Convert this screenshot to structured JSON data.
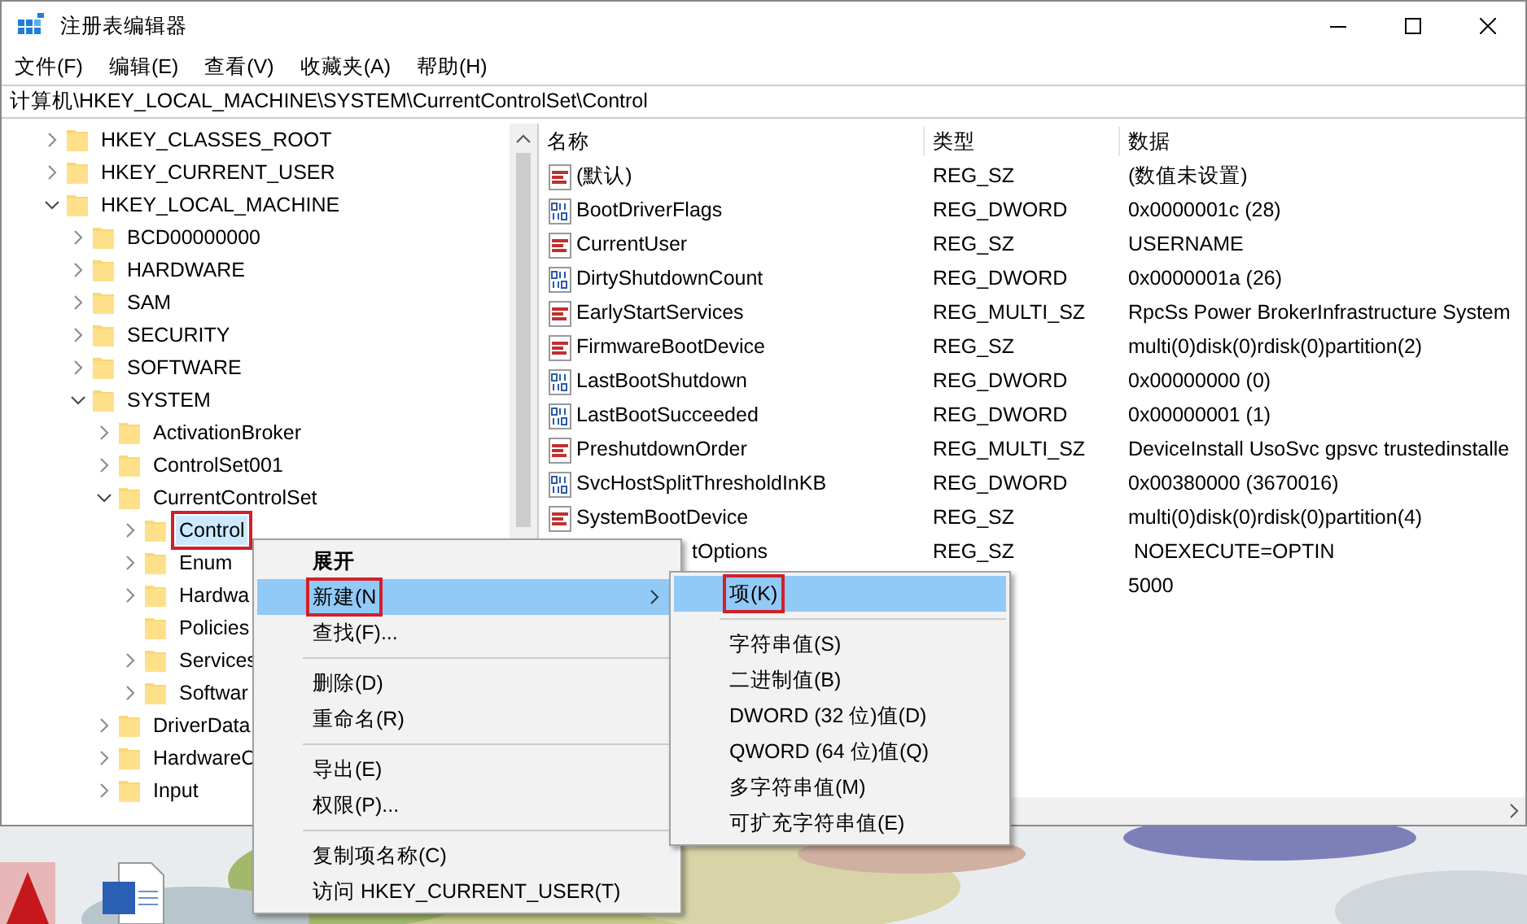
{
  "window": {
    "title": "注册表编辑器"
  },
  "menu_bar": [
    "文件(F)",
    "编辑(E)",
    "查看(V)",
    "收藏夹(A)",
    "帮助(H)"
  ],
  "address": "计算机\\HKEY_LOCAL_MACHINE\\SYSTEM\\CurrentControlSet\\Control",
  "tree": [
    {
      "label": "HKEY_CLASSES_ROOT",
      "expanded": false,
      "selected": false
    },
    {
      "label": "HKEY_CURRENT_USER",
      "expanded": false,
      "selected": false
    },
    {
      "label": "HKEY_LOCAL_MACHINE",
      "expanded": true,
      "selected": false,
      "children": [
        {
          "label": "BCD00000000",
          "expanded": false,
          "selected": false
        },
        {
          "label": "HARDWARE",
          "expanded": false,
          "selected": false
        },
        {
          "label": "SAM",
          "expanded": false,
          "selected": false
        },
        {
          "label": "SECURITY",
          "expanded": false,
          "selected": false
        },
        {
          "label": "SOFTWARE",
          "expanded": false,
          "selected": false
        },
        {
          "label": "SYSTEM",
          "expanded": true,
          "selected": false,
          "children": [
            {
              "label": "ActivationBroker",
              "expanded": false,
              "selected": false
            },
            {
              "label": "ControlSet001",
              "expanded": false,
              "selected": false
            },
            {
              "label": "CurrentControlSet",
              "expanded": true,
              "selected": false,
              "children": [
                {
                  "label": "Control",
                  "expanded": false,
                  "selected": true,
                  "annotated": true
                },
                {
                  "label": "Enum",
                  "expanded": false,
                  "selected": false
                },
                {
                  "label": "Hardwa",
                  "expanded": false,
                  "selected": false
                },
                {
                  "label": "Policies",
                  "selected": false
                },
                {
                  "label": "Services",
                  "expanded": false,
                  "selected": false
                },
                {
                  "label": "Softwar",
                  "expanded": false,
                  "selected": false
                }
              ]
            },
            {
              "label": "DriverData",
              "expanded": false,
              "selected": false
            },
            {
              "label": "HardwareC",
              "expanded": false,
              "selected": false
            },
            {
              "label": "Input",
              "expanded": false,
              "selected": false
            }
          ]
        }
      ]
    }
  ],
  "values_table": {
    "columns": [
      "名称",
      "类型",
      "数据"
    ],
    "rows": [
      {
        "kind": "string",
        "name": "(默认)",
        "type": "REG_SZ",
        "data": "(数值未设置)"
      },
      {
        "kind": "binary",
        "name": "BootDriverFlags",
        "type": "REG_DWORD",
        "data": "0x0000001c (28)"
      },
      {
        "kind": "string",
        "name": "CurrentUser",
        "type": "REG_SZ",
        "data": "USERNAME"
      },
      {
        "kind": "binary",
        "name": "DirtyShutdownCount",
        "type": "REG_DWORD",
        "data": "0x0000001a (26)"
      },
      {
        "kind": "string",
        "name": "EarlyStartServices",
        "type": "REG_MULTI_SZ",
        "data": "RpcSs Power BrokerInfrastructure System"
      },
      {
        "kind": "string",
        "name": "FirmwareBootDevice",
        "type": "REG_SZ",
        "data": "multi(0)disk(0)rdisk(0)partition(2)"
      },
      {
        "kind": "binary",
        "name": "LastBootShutdown",
        "type": "REG_DWORD",
        "data": "0x00000000 (0)"
      },
      {
        "kind": "binary",
        "name": "LastBootSucceeded",
        "type": "REG_DWORD",
        "data": "0x00000001 (1)"
      },
      {
        "kind": "string",
        "name": "PreshutdownOrder",
        "type": "REG_MULTI_SZ",
        "data": "DeviceInstall UsoSvc gpsvc trustedinstalle"
      },
      {
        "kind": "binary",
        "name": "SvcHostSplitThresholdInKB",
        "type": "REG_DWORD",
        "data": "0x00380000 (3670016)"
      },
      {
        "kind": "string",
        "name": "SystemBootDevice",
        "type": "REG_SZ",
        "data": "multi(0)disk(0)rdisk(0)partition(4)"
      },
      {
        "kind": "covered",
        "name": "tOptions",
        "type": "REG_SZ",
        "data": " NOEXECUTE=OPTIN"
      },
      {
        "kind": "covered",
        "data": "5000"
      }
    ]
  },
  "context_menu": {
    "groups": [
      [
        {
          "label": "展开",
          "default": true,
          "selected": false
        },
        {
          "label": "新建(N",
          "selected": true,
          "submenu": true,
          "annotated": true
        },
        {
          "label": "查找(F)...",
          "selected": false
        }
      ],
      [
        {
          "label": "删除(D)",
          "selected": false
        },
        {
          "label": "重命名(R)",
          "selected": false
        }
      ],
      [
        {
          "label": "导出(E)",
          "selected": false
        },
        {
          "label": "权限(P)...",
          "selected": false
        }
      ],
      [
        {
          "label": "复制项名称(C)",
          "selected": false
        },
        {
          "label": "访问 HKEY_CURRENT_USER(T)",
          "selected": false
        }
      ]
    ]
  },
  "submenu": {
    "groups": [
      [
        {
          "label": "项(K)",
          "selected": true,
          "annotated": true
        }
      ],
      [
        {
          "label": "字符串值(S)",
          "selected": false
        },
        {
          "label": "二进制值(B)",
          "selected": false
        },
        {
          "label": "DWORD (32 位)值(D)",
          "selected": false
        },
        {
          "label": "QWORD (64 位)值(Q)",
          "selected": false
        },
        {
          "label": "多字符串值(M)",
          "selected": false
        },
        {
          "label": "可扩充字符串值(E)",
          "selected": false
        }
      ]
    ]
  }
}
